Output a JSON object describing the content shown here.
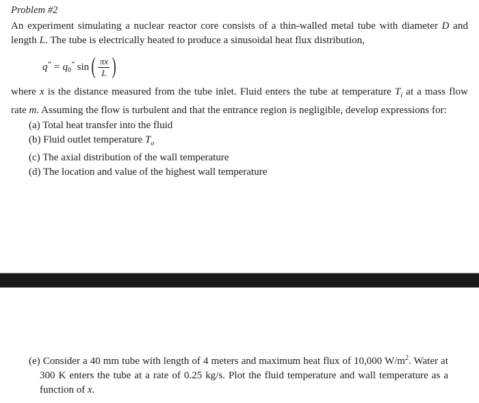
{
  "document": {
    "title": "Problem #2",
    "background_color": "#ffffff",
    "text_color": "#1b1b1b"
  },
  "problem": {
    "heading": "Problem #2",
    "intro_part1": "An experiment simulating a nuclear reactor core consists of a thin-walled metal tube with diameter ",
    "intro_var_D": "D",
    "intro_part2": " and length ",
    "intro_var_L": "L",
    "intro_part3": ".  The tube is electrically heated to produce a sinusoidal heat flux distribution,",
    "equation": {
      "lhs_symbol": "q",
      "lhs_primes": "″",
      "equals": "=",
      "rhs_symbol": "q",
      "rhs_subscript": "0",
      "rhs_primes": "″",
      "function": "sin",
      "numerator": "πx",
      "denominator": "L",
      "plain_text": "q″ = q₀″ sin(πx / L)"
    },
    "after_eq_part1": "where ",
    "after_eq_var_x": "x",
    "after_eq_part2": " is the distance measured from the tube inlet.  Fluid enters the tube at temperature ",
    "after_eq_var_Ti": "T",
    "after_eq_sub_i": "i",
    "after_eq_part3": " at a mass flow rate ",
    "after_eq_var_m": "m",
    "after_eq_part4": ".  Assuming the flow is turbulent and that the entrance region is negligible, develop expressions for:",
    "sub_items": [
      {
        "label": "(a)",
        "text": "Total heat transfer into the fluid",
        "var": "",
        "sub": ""
      },
      {
        "label": "(b)",
        "text": "Fluid outlet temperature ",
        "var": "T",
        "sub": "o"
      },
      {
        "label": "(c)",
        "text": "The axial distribution of the wall temperature",
        "var": "",
        "sub": ""
      },
      {
        "label": "(d)",
        "text": "The location and value of the highest wall temperature",
        "var": "",
        "sub": ""
      }
    ]
  },
  "divider": {
    "color": "#1a1a1a",
    "edge_color": "#8e8e8e"
  },
  "item_e": {
    "label": "(e)",
    "text_part1": " Consider a 40 mm tube with length of 4 meters and maximum heat flux of 10,000 W/m",
    "superscript": "2",
    "text_part2": ".  Water at 300 K enters the tube at a rate of 0.25 kg/s.  Plot the fluid temperature and wall temperature as a function of ",
    "var_x": "x",
    "text_part3": "."
  }
}
